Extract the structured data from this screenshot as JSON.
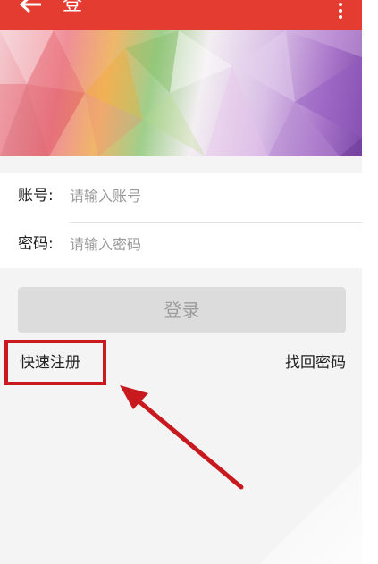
{
  "topbar": {
    "title": "登",
    "back_icon": "arrow-left-icon",
    "menu_icon": "more-vertical-icon",
    "color": "#e53c32"
  },
  "form": {
    "account_label": "账号:",
    "account_placeholder": "请输入账号",
    "password_label": "密码:",
    "password_placeholder": "请输入密码"
  },
  "actions": {
    "login_label": "登录",
    "register_label": "快速注册",
    "forgot_label": "找回密码"
  },
  "annotation": {
    "color": "#c8191e"
  }
}
